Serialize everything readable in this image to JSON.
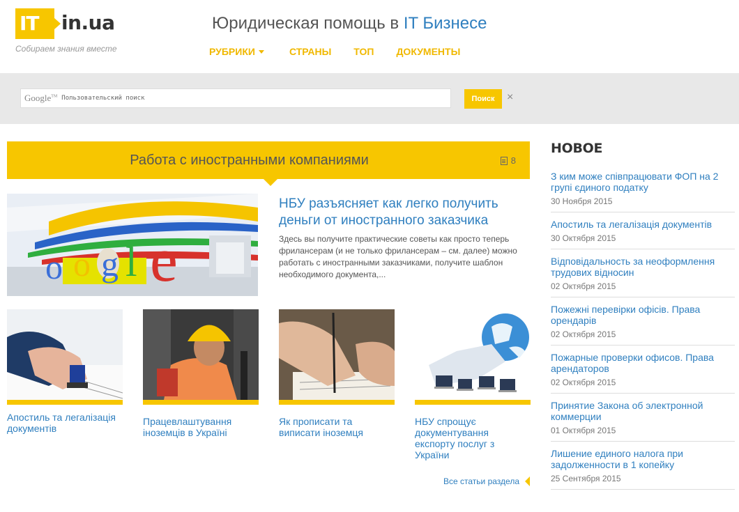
{
  "brand": {
    "logo_box": "IT",
    "logo_text": "in.ua",
    "slogan": "Собираем знания вместе",
    "accent_color": "#f7c600",
    "link_color": "#2f7fbf"
  },
  "header": {
    "title_main": "Юридическая помощь в ",
    "title_accent": "IT Бизнесе",
    "nav": [
      {
        "label": "РУБРИКИ",
        "has_dropdown": true
      },
      {
        "label": "СТРАНЫ"
      },
      {
        "label": "ТОП"
      },
      {
        "label": "ДОКУМЕНТЫ"
      }
    ]
  },
  "search": {
    "brand_mark": "Google",
    "brand_tm": "TM",
    "placeholder": "Пользовательский поиск",
    "button_label": "Поиск",
    "clear_symbol": "×"
  },
  "section": {
    "title": "Работа с иностранными компаниями",
    "count": "8",
    "all_link": "Все статьи раздела"
  },
  "featured": {
    "title": "НБУ разъясняет как легко получить деньги от иностранного заказчика",
    "excerpt": "Здесь вы получите практические советы как просто теперь фрилансерам (и не только фрилансерам – см. далее) можно работать с иностранными заказчиками, получите шаблон необходимого документа,..."
  },
  "cards": [
    {
      "title": "Апостиль та легалізація документів",
      "image": "stamp-hand-image"
    },
    {
      "title": "Працевлаштування іноземців в Україні",
      "image": "worker-helmet-image"
    },
    {
      "title": "Як прописати та виписати іноземця",
      "image": "signing-document-image"
    },
    {
      "title": "НБУ спрощує документування експорту послуг з України",
      "image": "globe-laptops-image"
    }
  ],
  "sidebar": {
    "title": "НОВОЕ",
    "items": [
      {
        "title": "З ким може співпрацювати ФОП на 2 групі єдиного податку",
        "date": "30 Ноября 2015"
      },
      {
        "title": "Апостиль та легалізація документів",
        "date": "30 Октября 2015"
      },
      {
        "title": "Відповідальность за неоформлення трудових відносин",
        "date": "02 Октября 2015"
      },
      {
        "title": "Пожежні перевірки офісів. Права орендарів",
        "date": "02 Октября 2015"
      },
      {
        "title": "Пожарные проверки офисов. Права арендаторов",
        "date": "02 Октября 2015"
      },
      {
        "title": "Принятие Закона об электронной коммерции",
        "date": "01 Октября 2015"
      },
      {
        "title": "Лишение единого налога при задолженности в 1 копейку",
        "date": "25 Сентября 2015"
      }
    ]
  }
}
